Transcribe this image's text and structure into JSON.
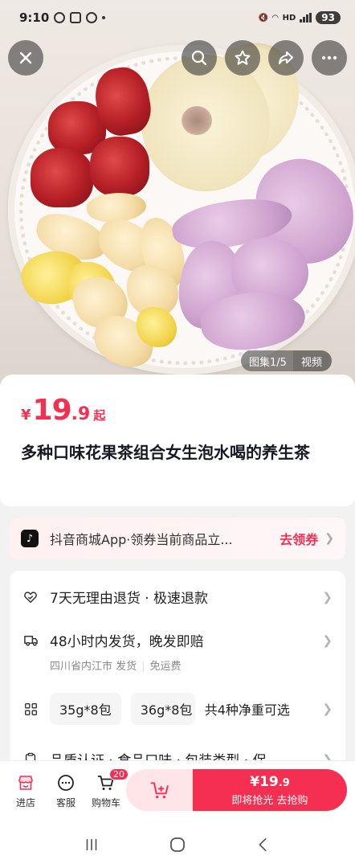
{
  "status_bar": {
    "time": "9:10",
    "network": "HD",
    "battery": "93"
  },
  "gallery": {
    "counter": "图集1/5",
    "video_tab": "视频"
  },
  "product": {
    "price": {
      "currency": "¥",
      "integer": "19",
      "decimal": ".9",
      "suffix": "起"
    },
    "title": "多种口味花果茶组合女生泡水喝的养生茶"
  },
  "coupon": {
    "text": "抖音商城App·领券当前商品立...",
    "action": "去领券"
  },
  "services": {
    "returns": "7天无理由退货 · 极速退款",
    "shipping": "48小时内发货，晚发即赔",
    "ship_from": "四川省内江市 发货",
    "shipping_fee": "免运费",
    "spec_options": [
      "35g*8包",
      "36g*8包"
    ],
    "spec_total": "共4种净重可选",
    "attributes": "品质认证 · 食品口味 · 包装类型 · 保"
  },
  "bottom_bar": {
    "store_label": "进店",
    "service_label": "客服",
    "cart_label": "购物车",
    "cart_count": "20",
    "buy_price": "¥19",
    "buy_price_decimal": ".9",
    "buy_text": "即将抢光  去抢购"
  },
  "colors": {
    "accent": "#f52f52",
    "coupon_bg": "#fff0f2"
  }
}
